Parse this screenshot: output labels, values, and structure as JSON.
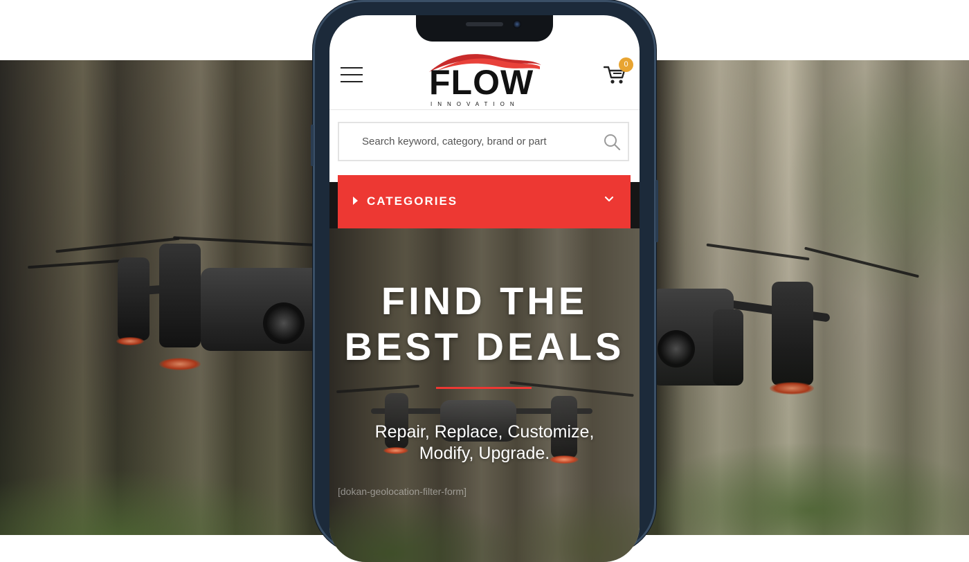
{
  "header": {
    "logo_title": "FLOW",
    "logo_subtitle": "INNOVATION",
    "cart_count": "0",
    "brand_color": "#ed3833",
    "badge_color": "#e8a431"
  },
  "search": {
    "placeholder": "Search keyword, category, brand or part",
    "value": ""
  },
  "categories": {
    "label": "CATEGORIES"
  },
  "hero": {
    "title_line1": "FIND THE",
    "title_line2": "BEST DEALS",
    "subtitle_line1": "Repair, Replace, Customize,",
    "subtitle_line2": "Modify, Upgrade.",
    "shortcode": "[dokan-geolocation-filter-form]"
  },
  "icons": [
    "hamburger-menu-icon",
    "cart-icon",
    "search-icon",
    "caret-right-icon",
    "chevron-down-icon"
  ]
}
